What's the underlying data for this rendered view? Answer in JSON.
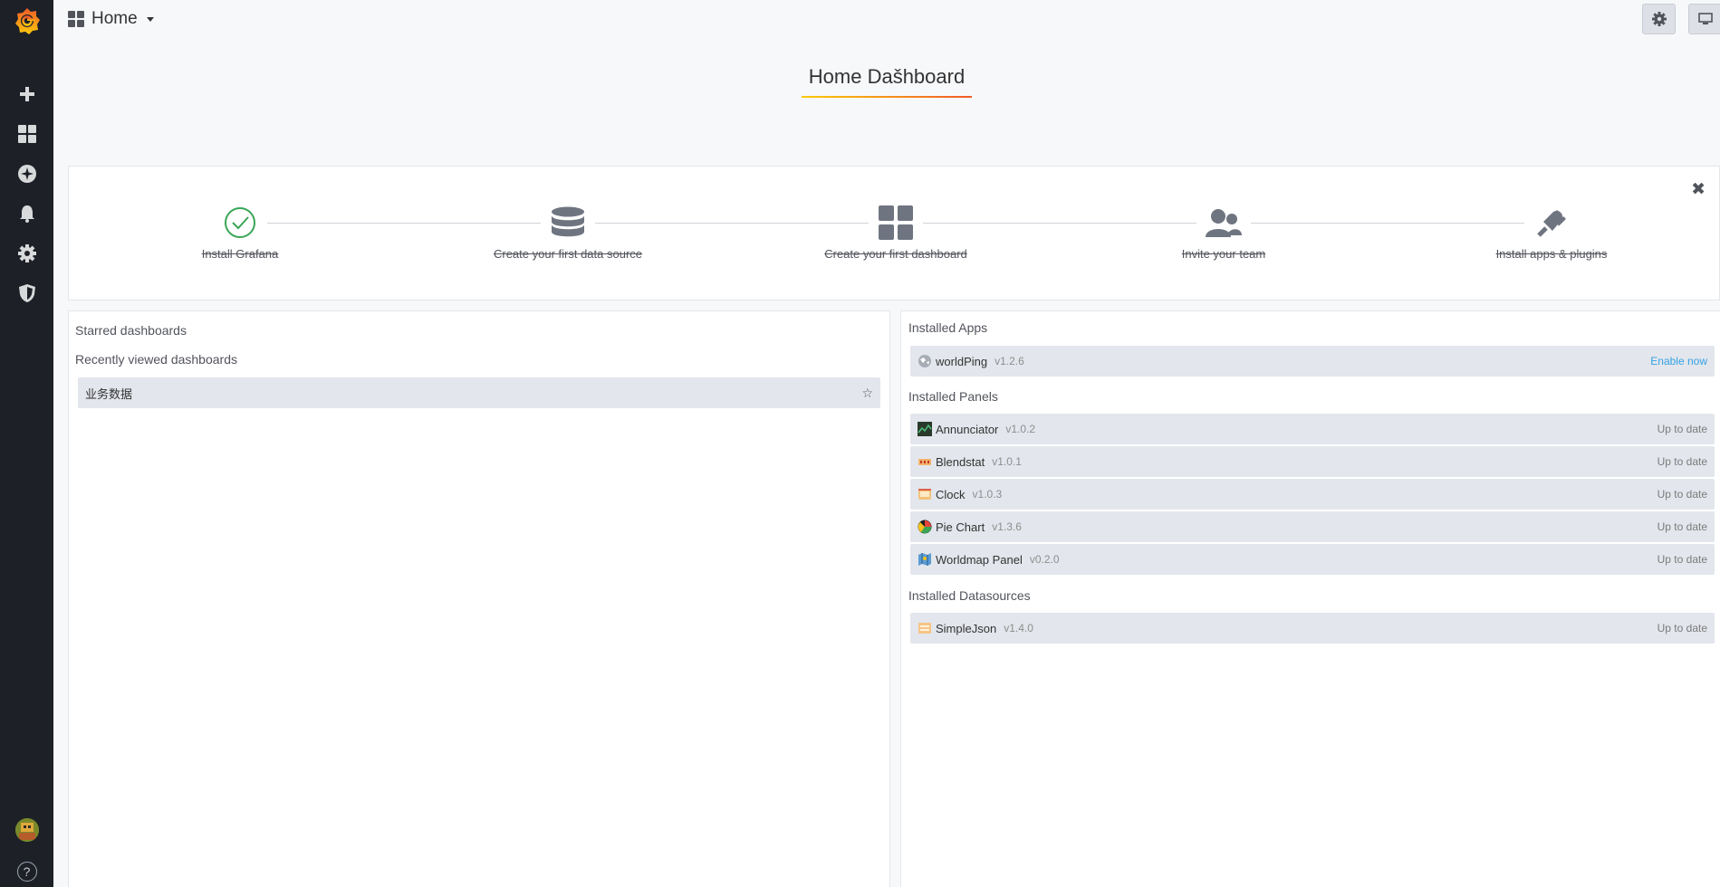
{
  "topbar": {
    "dashboard_picker": "Home"
  },
  "title": "Home Dašhboard",
  "getting_started": {
    "steps": [
      {
        "label": "Install Grafana",
        "icon": "check-circle-icon"
      },
      {
        "label": "Create your first data source",
        "icon": "database-icon"
      },
      {
        "label": "Create your first dashboard",
        "icon": "apps-icon"
      },
      {
        "label": "Invite your team",
        "icon": "users-icon"
      },
      {
        "label": "Install apps & plugins",
        "icon": "plug-icon"
      }
    ]
  },
  "left": {
    "starred_heading": "Starred dashboards",
    "recent_heading": "Recently viewed dashboards",
    "recent": [
      {
        "name": "业务数据"
      }
    ]
  },
  "right": {
    "apps_heading": "Installed Apps",
    "apps": [
      {
        "name": "worldPing",
        "version": "v1.2.6",
        "state": "Enable now"
      }
    ],
    "panels_heading": "Installed Panels",
    "panels": [
      {
        "name": "Annunciator",
        "version": "v1.0.2",
        "state": "Up to date"
      },
      {
        "name": "Blendstat",
        "version": "v1.0.1",
        "state": "Up to date"
      },
      {
        "name": "Clock",
        "version": "v1.0.3",
        "state": "Up to date"
      },
      {
        "name": "Pie Chart",
        "version": "v1.3.6",
        "state": "Up to date"
      },
      {
        "name": "Worldmap Panel",
        "version": "v0.2.0",
        "state": "Up to date"
      }
    ],
    "datasources_heading": "Installed Datasources",
    "datasources": [
      {
        "name": "SimpleJson",
        "version": "v1.4.0",
        "state": "Up to date"
      }
    ]
  },
  "sidebar": {
    "help": "?"
  },
  "colors": {
    "sidebar_bg": "#1e2028",
    "accent_link": "#33a2e5",
    "check_green": "#3aa655",
    "step_gray": "#6f7580"
  }
}
